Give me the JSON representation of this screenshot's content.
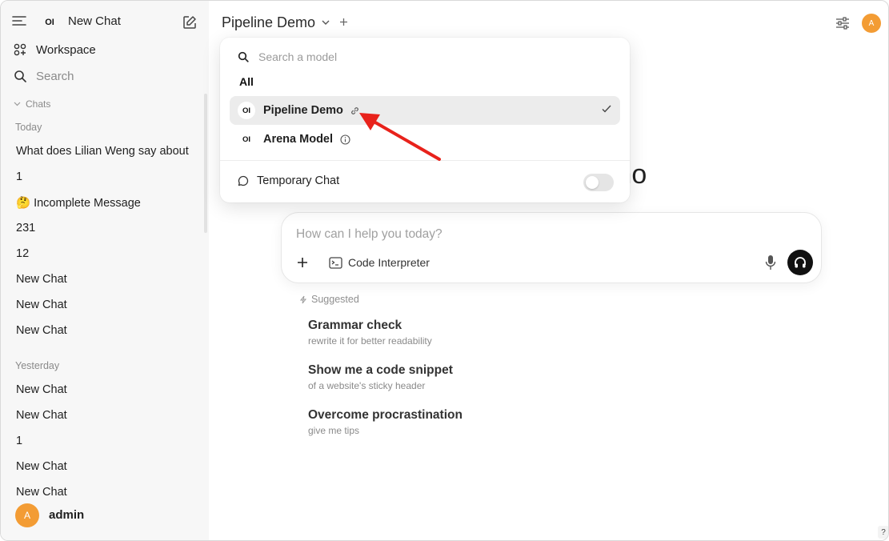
{
  "sidebar": {
    "new_chat_label": "New Chat",
    "logo_text": "OI",
    "workspace_label": "Workspace",
    "search_label": "Search",
    "chats_label": "Chats",
    "groups": [
      {
        "label": "Today",
        "items": [
          "What does Lilian Weng say about",
          "1",
          "🤔 Incomplete Message",
          "231",
          "12",
          "New Chat",
          "New Chat",
          "New Chat"
        ]
      },
      {
        "label": "Yesterday",
        "items": [
          "New Chat",
          "New Chat",
          "1",
          "New Chat",
          "New Chat"
        ]
      }
    ],
    "user": {
      "avatar_letter": "A",
      "name": "admin"
    }
  },
  "header": {
    "model_title": "Pipeline Demo",
    "avatar_letter": "A"
  },
  "background_title_fragment": "mo",
  "model_dropdown": {
    "search_placeholder": "Search a model",
    "filter_label": "All",
    "models": [
      {
        "logo": "OI",
        "name": "Pipeline Demo",
        "suffix_icon": "link-icon",
        "selected": true
      },
      {
        "logo": "OI",
        "name": "Arena Model",
        "suffix_icon": "info-icon",
        "selected": false
      }
    ],
    "temporary_chat_label": "Temporary Chat",
    "temporary_chat_enabled": false
  },
  "input": {
    "placeholder": "How can I help you today?",
    "code_interpreter_label": "Code Interpreter"
  },
  "suggestions": {
    "heading": "Suggested",
    "items": [
      {
        "title": "Grammar check",
        "subtitle": "rewrite it for better readability"
      },
      {
        "title": "Show me a code snippet",
        "subtitle": "of a website's sticky header"
      },
      {
        "title": "Overcome procrastination",
        "subtitle": "give me tips"
      }
    ]
  },
  "help_label": "?",
  "colors": {
    "sidebar_bg": "#f7f7f7",
    "avatar": "#f39c34",
    "selected_row": "#ececec",
    "annotation_arrow": "#e8221b"
  }
}
